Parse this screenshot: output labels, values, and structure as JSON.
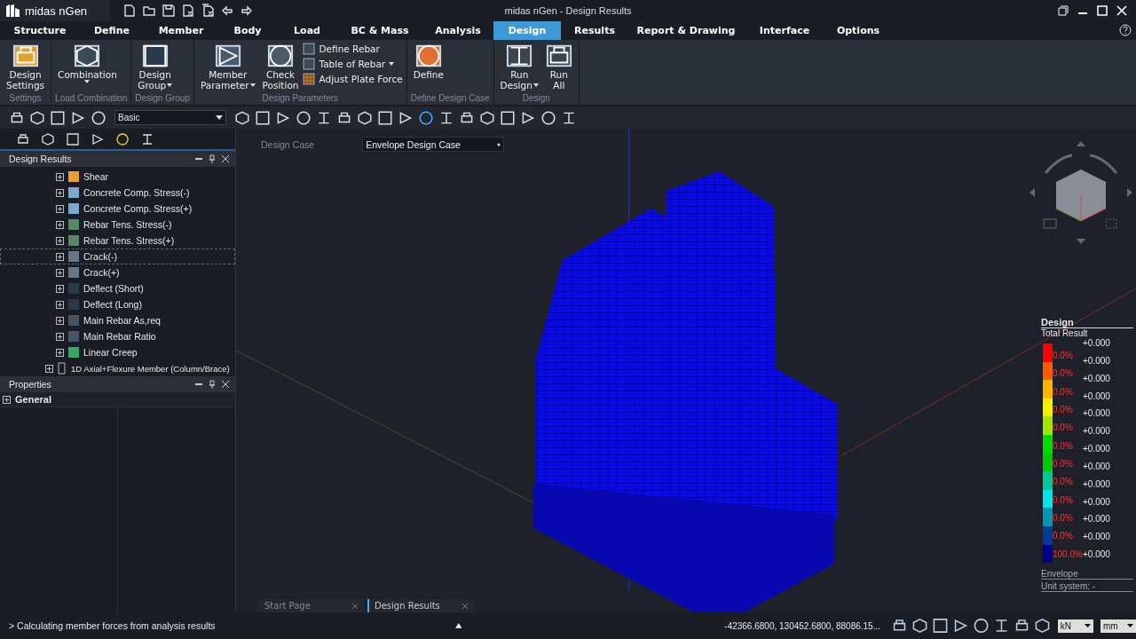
{
  "window": {
    "app_name": "midas nGen",
    "title": "midas nGen - Design Results"
  },
  "menu_tabs": [
    {
      "label": "Structure",
      "selected": false
    },
    {
      "label": "Define",
      "selected": false
    },
    {
      "label": "Member",
      "selected": false
    },
    {
      "label": "Body",
      "selected": false
    },
    {
      "label": "Load",
      "selected": false
    },
    {
      "label": "BC & Mass",
      "selected": false
    },
    {
      "label": "Analysis",
      "selected": false
    },
    {
      "label": "Design",
      "selected": true
    },
    {
      "label": "Results",
      "selected": false
    },
    {
      "label": "Report & Drawing",
      "selected": false
    },
    {
      "label": "Interface",
      "selected": false
    },
    {
      "label": "Options",
      "selected": false
    }
  ],
  "ribbon_groups": [
    {
      "label": "Settings",
      "items": [
        {
          "kind": "large",
          "lines": [
            "Design",
            "Settings"
          ],
          "dropdown": false
        }
      ]
    },
    {
      "label": "Load Combination",
      "items": [
        {
          "kind": "large",
          "lines": [
            "Combination"
          ],
          "dropdown": true
        }
      ]
    },
    {
      "label": "Design Group",
      "items": [
        {
          "kind": "large",
          "lines": [
            "Design",
            "Group"
          ],
          "dropdown": true
        }
      ]
    },
    {
      "label": "Design Parameters",
      "items": [
        {
          "kind": "large",
          "lines": [
            "Member",
            "Parameter"
          ],
          "dropdown": true
        },
        {
          "kind": "large",
          "lines": [
            "Check",
            "Position"
          ],
          "dropdown": false
        },
        {
          "kind": "small",
          "lines": [
            "Define Rebar"
          ],
          "dropdown": false
        },
        {
          "kind": "small",
          "lines": [
            "Table of Rebar"
          ],
          "dropdown": true
        },
        {
          "kind": "small",
          "lines": [
            "Adjust Plate Force"
          ],
          "dropdown": false
        }
      ]
    },
    {
      "label": "Define Design Case",
      "items": [
        {
          "kind": "large",
          "lines": [
            "Define"
          ],
          "dropdown": false
        }
      ]
    },
    {
      "label": "Design",
      "items": [
        {
          "kind": "large",
          "lines": [
            "Run",
            "Design"
          ],
          "dropdown": true
        },
        {
          "kind": "large",
          "lines": [
            "Run",
            "All"
          ],
          "dropdown": false
        }
      ]
    }
  ],
  "toolbar": {
    "view_mode": "Basic"
  },
  "design_results": {
    "title": "Design Results",
    "tree": [
      {
        "children": [
          {
            "label": "Shear",
            "expanded": false,
            "selected": false
          },
          {
            "label": "Concrete Comp. Stress(-)",
            "expanded": false,
            "selected": false
          },
          {
            "label": "Concrete Comp. Stress(+)",
            "expanded": false,
            "selected": false
          },
          {
            "label": "Rebar Tens. Stress(-)",
            "expanded": false,
            "selected": false
          },
          {
            "label": "Rebar Tens. Stress(+)",
            "expanded": false,
            "selected": false
          },
          {
            "label": "Crack(-)",
            "expanded": false,
            "selected": true
          },
          {
            "label": "Crack(+)",
            "expanded": false,
            "selected": false
          },
          {
            "label": "Deflect (Short)",
            "expanded": false,
            "selected": false
          },
          {
            "label": "Deflect (Long)",
            "expanded": false,
            "selected": false
          },
          {
            "label": "Main Rebar As,req",
            "expanded": false,
            "selected": false
          },
          {
            "label": "Main Rebar Ratio",
            "expanded": false,
            "selected": false
          },
          {
            "label": "Linear Creep",
            "expanded": false,
            "selected": false
          }
        ]
      },
      {
        "label": "1D Axial+Flexure Member (Column/Brace)",
        "expanded": false,
        "selected": false
      }
    ]
  },
  "properties": {
    "title": "Properties",
    "groups": [
      {
        "label": "General",
        "expanded": false
      }
    ]
  },
  "viewport": {
    "design_case_label": "Design Case",
    "design_case_value": "Envelope Design Case"
  },
  "legend": {
    "title": "Design",
    "subtitle": "Total Result",
    "bands": [
      {
        "color": "#ff0000",
        "percent": "0.0%"
      },
      {
        "color": "#ff5a00",
        "percent": "0.0%"
      },
      {
        "color": "#ffb400",
        "percent": "0.0%"
      },
      {
        "color": "#f0f000",
        "percent": "0.0%"
      },
      {
        "color": "#a0e600",
        "percent": "0.0%"
      },
      {
        "color": "#00dc00",
        "percent": "0.0%"
      },
      {
        "color": "#00c800",
        "percent": "0.0%"
      },
      {
        "color": "#00c896",
        "percent": "0.0%"
      },
      {
        "color": "#00e6e6",
        "percent": "0.0%"
      },
      {
        "color": "#0096b4",
        "percent": "0.0%"
      },
      {
        "color": "#003c96",
        "percent": "0.0%"
      },
      {
        "color": "#00008c",
        "percent": "100.0%"
      }
    ],
    "values": [
      "+0.000",
      "+0.000",
      "+0.000",
      "+0.000",
      "+0.000",
      "+0.000",
      "+0.000",
      "+0.000",
      "+0.000",
      "+0.000",
      "+0.000",
      "+0.000",
      "+0.000"
    ],
    "footer": "Envelope",
    "unit_system": "Unit system: -"
  },
  "doc_tabs": [
    {
      "label": "Start Page",
      "selected": false
    },
    {
      "label": "Design Results",
      "selected": true
    }
  ],
  "status_bar": {
    "message": "> Calculating member forces from analysis results",
    "coordinates": "-42366.6800, 130452.6800, 88086.15...",
    "force_unit": "kN",
    "length_unit": "mm"
  }
}
